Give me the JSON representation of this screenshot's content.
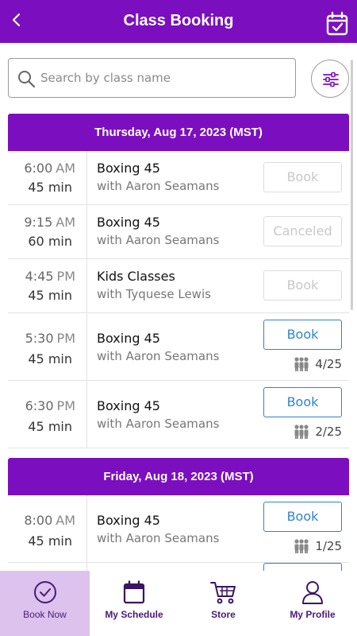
{
  "header": {
    "title": "Class Booking",
    "back_icon": "chevron-left-icon",
    "calendar_icon": "calendar-check-icon"
  },
  "search": {
    "placeholder": "Search by class name",
    "value": ""
  },
  "colors": {
    "brand": "#7b0fbf",
    "book_active": "#2f84d1",
    "book_disabled": "#c8c8c8",
    "nav_active_bg": "#dcc2ec"
  },
  "days": [
    {
      "heading": "Thursday, Aug 17, 2023 (MST)",
      "classes": [
        {
          "time": "6:00",
          "ampm": "AM",
          "duration": "45 min",
          "name": "Boxing 45",
          "instructor": "with Aaron Seamans",
          "button": "Book",
          "state": "disabled",
          "capacity": ""
        },
        {
          "time": "9:15",
          "ampm": "AM",
          "duration": "60 min",
          "name": "Boxing 45",
          "instructor": "with Aaron Seamans",
          "button": "Canceled",
          "state": "disabled",
          "capacity": ""
        },
        {
          "time": "4:45",
          "ampm": "PM",
          "duration": "45 min",
          "name": "Kids Classes",
          "instructor": "with Tyquese Lewis",
          "button": "Book",
          "state": "disabled",
          "capacity": ""
        },
        {
          "time": "5:30",
          "ampm": "PM",
          "duration": "45 min",
          "name": "Boxing 45",
          "instructor": "with Aaron Seamans",
          "button": "Book",
          "state": "active",
          "capacity": "4/25"
        },
        {
          "time": "6:30",
          "ampm": "PM",
          "duration": "45 min",
          "name": "Boxing 45",
          "instructor": "with Aaron Seamans",
          "button": "Book",
          "state": "active",
          "capacity": "2/25"
        }
      ]
    },
    {
      "heading": "Friday, Aug 18, 2023 (MST)",
      "classes": [
        {
          "time": "8:00",
          "ampm": "AM",
          "duration": "45 min",
          "name": "Boxing 45",
          "instructor": "with Aaron Seamans",
          "button": "Book",
          "state": "active",
          "capacity": "1/25"
        }
      ]
    }
  ],
  "bottom_nav": [
    {
      "label": "Book Now",
      "icon": "check-circle-icon",
      "active": true
    },
    {
      "label": "My Schedule",
      "icon": "calendar-icon",
      "active": false
    },
    {
      "label": "Store",
      "icon": "cart-icon",
      "active": false
    },
    {
      "label": "My Profile",
      "icon": "user-icon",
      "active": false
    }
  ]
}
